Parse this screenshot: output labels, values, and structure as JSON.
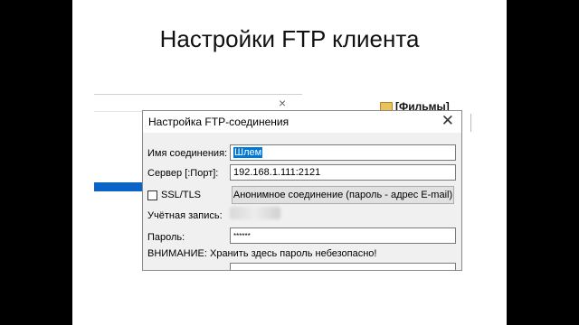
{
  "slide": {
    "title": "Настройки FTP клиента"
  },
  "background": {
    "close_glyph": "×",
    "folder_label": "[Фильмы]"
  },
  "dialog": {
    "title": "Настройка FTP-соединения",
    "close_glyph": "✕",
    "connection_name_label": "Имя соединения:",
    "connection_name_value": "Шлем",
    "server_label": "Сервер [:Порт]:",
    "server_value": "192.168.1.111:2121",
    "ssl_label": "SSL/TLS",
    "ssl_checked": false,
    "anonymous_button": "Анонимное соединение (пароль - адрес E-mail)",
    "account_label": "Учётная запись:",
    "password_label": "Пароль:",
    "password_value": "******",
    "warning": "ВНИМАНИЕ: Хранить здесь пароль небезопасно!"
  },
  "colors": {
    "accent": "#0078d7",
    "blue_bar": "#0a64c8"
  }
}
